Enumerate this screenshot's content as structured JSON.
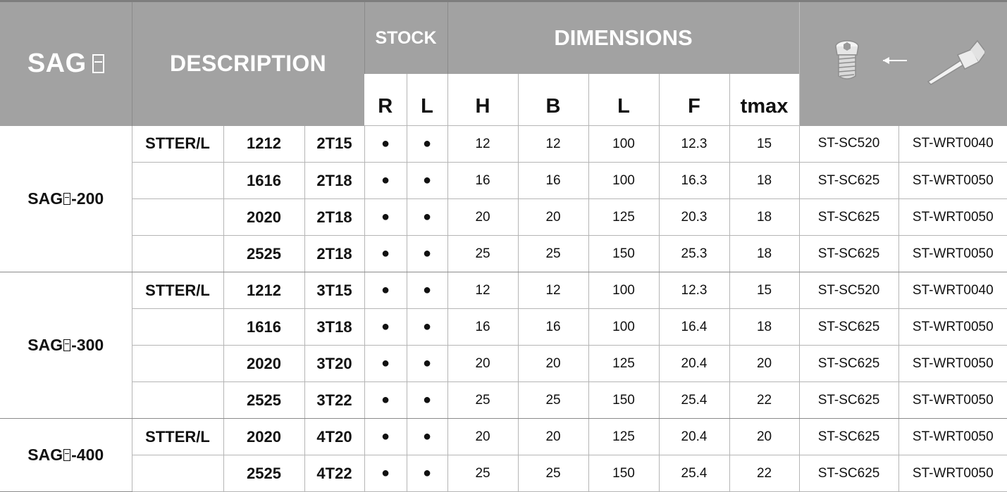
{
  "header": {
    "series_label": "SAG",
    "description_label": "DESCRIPTION",
    "stock_label": "STOCK",
    "dimensions_label": "DIMENSIONS",
    "sub_r": "R",
    "sub_l": "L",
    "dim_h": "H",
    "dim_b": "B",
    "dim_l": "L",
    "dim_f": "F",
    "dim_tmax": "tmax",
    "icons": [
      "screw-icon",
      "left-arrow-icon",
      "torx-wrench-icon"
    ]
  },
  "groups": [
    {
      "series_prefix": "SAG",
      "series_suffix": "-200",
      "rows": [
        {
          "type": "STTER/L",
          "size": "1212",
          "insert": "2T15",
          "r": "●",
          "l": "●",
          "h": "12",
          "b": "12",
          "len": "100",
          "f": "12.3",
          "tmax": "15",
          "screw": "ST-SC520",
          "wrench": "ST-WRT0040"
        },
        {
          "type": "",
          "size": "1616",
          "insert": "2T18",
          "r": "●",
          "l": "●",
          "h": "16",
          "b": "16",
          "len": "100",
          "f": "16.3",
          "tmax": "18",
          "screw": "ST-SC625",
          "wrench": "ST-WRT0050"
        },
        {
          "type": "",
          "size": "2020",
          "insert": "2T18",
          "r": "●",
          "l": "●",
          "h": "20",
          "b": "20",
          "len": "125",
          "f": "20.3",
          "tmax": "18",
          "screw": "ST-SC625",
          "wrench": "ST-WRT0050"
        },
        {
          "type": "",
          "size": "2525",
          "insert": "2T18",
          "r": "●",
          "l": "●",
          "h": "25",
          "b": "25",
          "len": "150",
          "f": "25.3",
          "tmax": "18",
          "screw": "ST-SC625",
          "wrench": "ST-WRT0050"
        }
      ]
    },
    {
      "series_prefix": "SAG",
      "series_suffix": "-300",
      "rows": [
        {
          "type": "STTER/L",
          "size": "1212",
          "insert": "3T15",
          "r": "●",
          "l": "●",
          "h": "12",
          "b": "12",
          "len": "100",
          "f": "12.3",
          "tmax": "15",
          "screw": "ST-SC520",
          "wrench": "ST-WRT0040"
        },
        {
          "type": "",
          "size": "1616",
          "insert": "3T18",
          "r": "●",
          "l": "●",
          "h": "16",
          "b": "16",
          "len": "100",
          "f": "16.4",
          "tmax": "18",
          "screw": "ST-SC625",
          "wrench": "ST-WRT0050"
        },
        {
          "type": "",
          "size": "2020",
          "insert": "3T20",
          "r": "●",
          "l": "●",
          "h": "20",
          "b": "20",
          "len": "125",
          "f": "20.4",
          "tmax": "20",
          "screw": "ST-SC625",
          "wrench": "ST-WRT0050"
        },
        {
          "type": "",
          "size": "2525",
          "insert": "3T22",
          "r": "●",
          "l": "●",
          "h": "25",
          "b": "25",
          "len": "150",
          "f": "25.4",
          "tmax": "22",
          "screw": "ST-SC625",
          "wrench": "ST-WRT0050"
        }
      ]
    },
    {
      "series_prefix": "SAG",
      "series_suffix": "-400",
      "rows": [
        {
          "type": "STTER/L",
          "size": "2020",
          "insert": "4T20",
          "r": "●",
          "l": "●",
          "h": "20",
          "b": "20",
          "len": "125",
          "f": "20.4",
          "tmax": "20",
          "screw": "ST-SC625",
          "wrench": "ST-WRT0050"
        },
        {
          "type": "",
          "size": "2525",
          "insert": "4T22",
          "r": "●",
          "l": "●",
          "h": "25",
          "b": "25",
          "len": "150",
          "f": "25.4",
          "tmax": "22",
          "screw": "ST-SC625",
          "wrench": "ST-WRT0050"
        }
      ]
    }
  ]
}
